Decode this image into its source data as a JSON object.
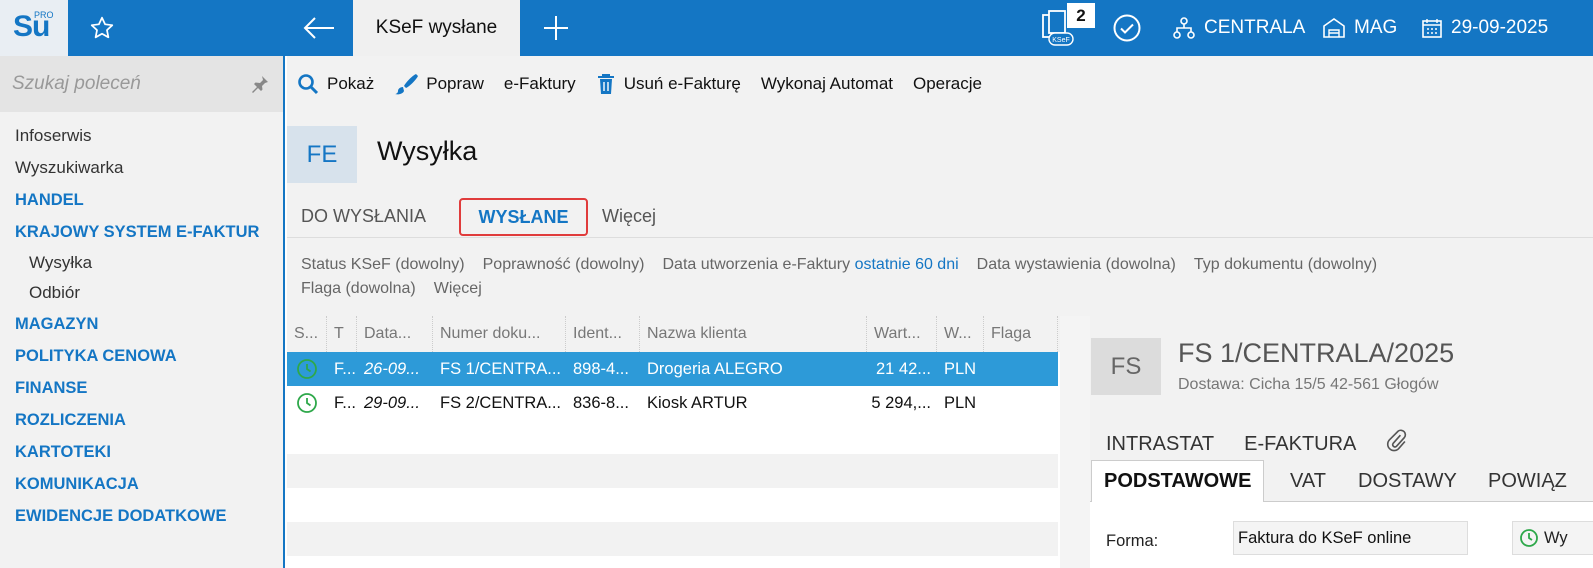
{
  "logo": {
    "text": "Su",
    "superscript": "PRO"
  },
  "topbar": {
    "active_tab": "KSeF wysłane",
    "ksef_badge_count": "2",
    "ksef_icon_label": "KSeF",
    "branch": "CENTRALA",
    "warehouse": "MAG",
    "date": "29-09-2025"
  },
  "sidebar": {
    "search_placeholder": "Szukaj poleceń",
    "items": [
      {
        "label": "Infoserwis",
        "kind": "plain"
      },
      {
        "label": "Wyszukiwarka",
        "kind": "plain"
      },
      {
        "label": "HANDEL",
        "kind": "head"
      },
      {
        "label": "KRAJOWY SYSTEM E-FAKTUR",
        "kind": "head"
      },
      {
        "label": "Wysyłka",
        "kind": "sub"
      },
      {
        "label": "Odbiór",
        "kind": "sub"
      },
      {
        "label": "MAGAZYN",
        "kind": "head"
      },
      {
        "label": "POLITYKA CENOWA",
        "kind": "head"
      },
      {
        "label": "FINANSE",
        "kind": "head"
      },
      {
        "label": "ROZLICZENIA",
        "kind": "head"
      },
      {
        "label": "KARTOTEKI",
        "kind": "head"
      },
      {
        "label": "KOMUNIKACJA",
        "kind": "head"
      },
      {
        "label": "EWIDENCJE DODATKOWE",
        "kind": "head"
      }
    ]
  },
  "toolbar": {
    "show": "Pokaż",
    "fix": "Popraw",
    "einvoices": "e-Faktury",
    "delete": "Usuń e-Fakturę",
    "automat": "Wykonaj Automat",
    "operations": "Operacje"
  },
  "page": {
    "badge": "FE",
    "title": "Wysyłka"
  },
  "subtabs": {
    "to_send": "DO WYSŁANIA",
    "sent": "WYSŁANE",
    "more": "Więcej"
  },
  "filters": {
    "status": "Status KSeF (dowolny)",
    "validity": "Poprawność (dowolny)",
    "created_label": "Data utworzenia e-Faktury",
    "created_value": "ostatnie 60 dni",
    "issued": "Data wystawienia (dowolna)",
    "doctype": "Typ dokumentu (dowolny)",
    "flag": "Flaga (dowolna)",
    "more": "Więcej"
  },
  "grid": {
    "columns": [
      "S...",
      "T",
      "Data...",
      "Numer doku...",
      "Ident...",
      "Nazwa klienta",
      "Wart...",
      "W...",
      "Flaga"
    ],
    "rows": [
      {
        "type": "F...",
        "date": "26-09...",
        "number": "FS 1/CENTRA...",
        "ident": "898-4...",
        "client": "Drogeria ALEGRO",
        "value": "21 42...",
        "currency": "PLN",
        "flag": ""
      },
      {
        "type": "F...",
        "date": "29-09...",
        "number": "FS 2/CENTRA...",
        "ident": "836-8...",
        "client": "Kiosk ARTUR",
        "value": "5 294,...",
        "currency": "PLN",
        "flag": ""
      }
    ]
  },
  "detail": {
    "badge": "FS",
    "title": "FS 1/CENTRALA/2025",
    "subtitle": "Dostawa: Cicha  15/5  42-561 Głogów",
    "tabs_top": [
      "INTRASTAT",
      "E-FAKTURA"
    ],
    "tabs": [
      "PODSTAWOWE",
      "VAT",
      "DOSTAWY",
      "POWIĄZ"
    ],
    "form_label": "Forma:",
    "form_value": "Faktura do KSeF online",
    "status_text": "Wy"
  },
  "colors": {
    "accent": "#1476c4",
    "selected_row": "#2d9ad8",
    "status_green": "#2ea84a",
    "highlight_border": "#e03c3c"
  }
}
